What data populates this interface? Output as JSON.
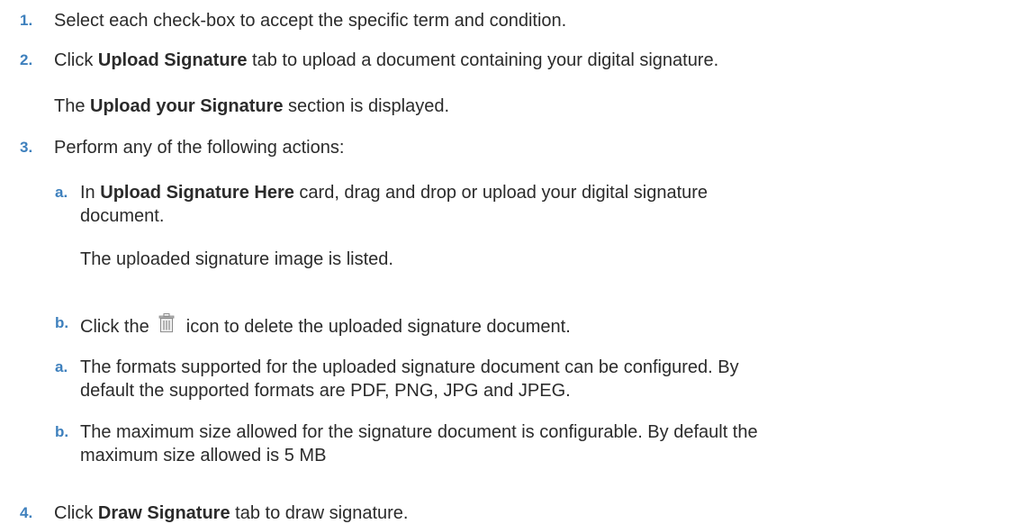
{
  "steps": [
    {
      "num": "1.",
      "text": "Select each check-box to accept the specific term and condition."
    },
    {
      "num": "2.",
      "pre": "Click ",
      "bold": "Upload Signature",
      "post": " tab to upload a document containing your digital signature.",
      "result_pre": "The ",
      "result_bold": "Upload your Signature",
      "result_post": " section is displayed."
    },
    {
      "num": "3.",
      "text": "Perform any of the following actions:",
      "substeps": [
        {
          "letter": "a.",
          "pre": "In ",
          "bold": "Upload Signature Here",
          "post_line1": " card, drag and drop or upload your digital signature",
          "post_line2": "document.",
          "result": "The uploaded signature image is listed."
        },
        {
          "letter": "b.",
          "pre": "Click the ",
          "icon": "trash-icon",
          "post": " icon to delete the uploaded signature document."
        }
      ],
      "notes": [
        {
          "letter": "a.",
          "line1": "The formats supported for the uploaded signature document can be configured. By",
          "line2": "default the supported formats are PDF, PNG, JPG and JPEG."
        },
        {
          "letter": "b.",
          "line1": "The maximum size allowed for the signature document is configurable. By default the",
          "line2": "maximum size allowed is 5 MB"
        }
      ]
    },
    {
      "num": "4.",
      "pre": "Click ",
      "bold": "Draw Signature",
      "post": " tab to draw signature."
    }
  ],
  "colors": {
    "numbering": "#3e80bd",
    "text": "#2b2b2b",
    "icon": "#8a8a8a"
  }
}
